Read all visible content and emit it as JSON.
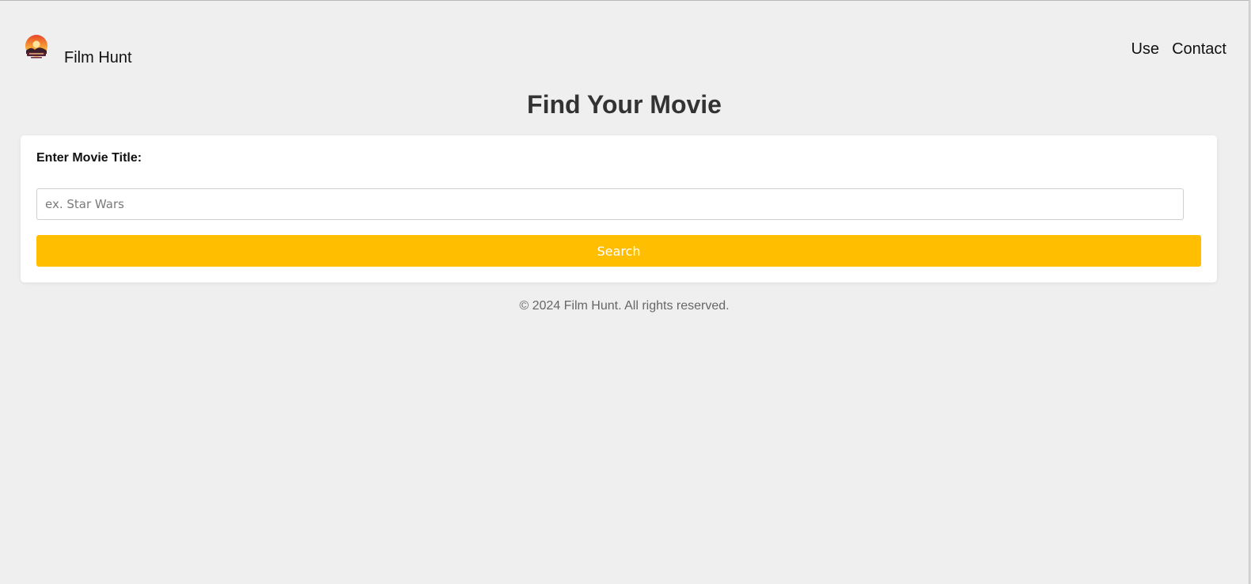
{
  "header": {
    "brand": "Film Hunt",
    "nav": [
      {
        "label": "Use"
      },
      {
        "label": "Contact"
      }
    ],
    "logo_icon": "film-hunt-logo-icon"
  },
  "main": {
    "title": "Find Your Movie",
    "form": {
      "label": "Enter Movie Title:",
      "input_value": "",
      "placeholder": "ex. Star Wars",
      "button_label": "Search"
    }
  },
  "footer": {
    "text": "© 2024 Film Hunt. All rights reserved."
  },
  "colors": {
    "background": "#efefef",
    "card": "#ffffff",
    "accent": "#ffbf00",
    "title": "#333333",
    "footer_text": "#666666"
  }
}
